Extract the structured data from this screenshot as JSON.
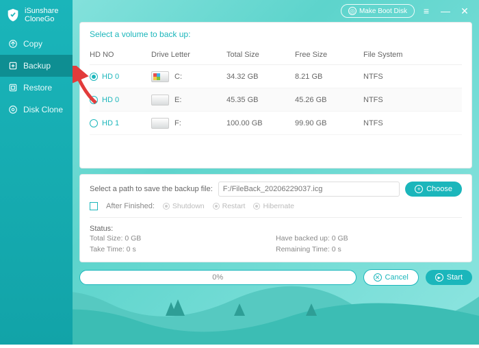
{
  "app": {
    "name_line1": "iSunshare",
    "name_line2": "CloneGo"
  },
  "titlebar": {
    "boot": "Make Boot Disk"
  },
  "sidebar": {
    "items": [
      {
        "label": "Copy"
      },
      {
        "label": "Backup"
      },
      {
        "label": "Restore"
      },
      {
        "label": "Disk Clone"
      }
    ]
  },
  "volumes": {
    "title": "Select a volume to back up:",
    "headers": {
      "hdno": "HD NO",
      "letter": "Drive Letter",
      "total": "Total Size",
      "free": "Free Size",
      "fs": "File System"
    },
    "rows": [
      {
        "hd": "HD 0",
        "letter": "C:",
        "total": "34.32 GB",
        "free": "8.21 GB",
        "fs": "NTFS",
        "selected": true,
        "sys": true
      },
      {
        "hd": "HD 0",
        "letter": "E:",
        "total": "45.35 GB",
        "free": "45.26 GB",
        "fs": "NTFS",
        "selected": false,
        "sys": false
      },
      {
        "hd": "HD 1",
        "letter": "F:",
        "total": "100.00 GB",
        "free": "99.90 GB",
        "fs": "NTFS",
        "selected": false,
        "sys": false
      }
    ]
  },
  "path": {
    "label": "Select a path to save the backup file:",
    "value": "F:/FileBack_20206229037.icg",
    "choose": "Choose",
    "after_label": "After Finished:",
    "opts": {
      "shutdown": "Shutdown",
      "restart": "Restart",
      "hibernate": "Hibernate"
    }
  },
  "status": {
    "title": "Status:",
    "total": "Total Size: 0 GB",
    "backed": "Have backed up: 0 GB",
    "take": "Take Time: 0 s",
    "remain": "Remaining Time: 0 s"
  },
  "bottom": {
    "progress": "0%",
    "cancel": "Cancel",
    "start": "Start"
  }
}
